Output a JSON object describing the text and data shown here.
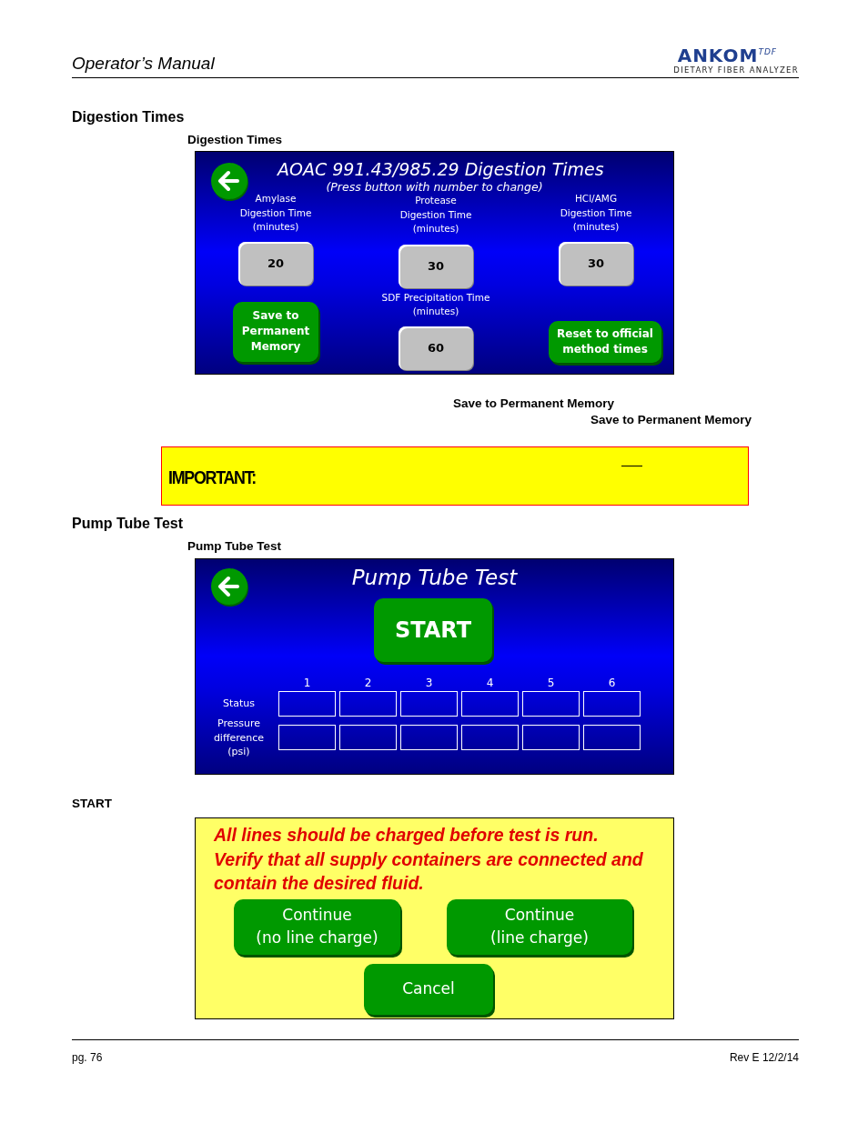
{
  "header": {
    "title": "Operator’s Manual",
    "logo": "ANKOM$^{TDF}$",
    "logo_tagline": "DIETARY FIBER ANALYZER"
  },
  "digestion": {
    "heading": "Digestion Times",
    "caption": "Digestion Times",
    "screen": {
      "title": "AOAC 991.43/985.29 Digestion Times",
      "subtitle": "(Press button with number to change)",
      "fields": [
        {
          "label": "Amylase\nDigestion Time\n(minutes)",
          "value": "20"
        },
        {
          "label": "Protease\nDigestion Time\n(minutes)",
          "value": "30"
        },
        {
          "label": "HCl/AMG\nDigestion Time\n(minutes)",
          "value": "30"
        },
        {
          "label": "SDF Precipitation Time\n(minutes)",
          "value": "60"
        }
      ],
      "save_button": "Save to\nPermanent\nMemory",
      "reset_button": "Reset to official\nmethod times"
    },
    "notes": [
      "Save to Permanent Memory",
      "Save to Permanent Memory"
    ]
  },
  "important": {
    "label": "IMPORTANT:"
  },
  "pump": {
    "heading": "Pump Tube Test",
    "caption": "Pump Tube Test",
    "screen": {
      "title": "Pump Tube Test",
      "start_button": "START",
      "columns": [
        "1",
        "2",
        "3",
        "4",
        "5",
        "6"
      ],
      "rows": [
        {
          "label": "Status"
        },
        {
          "label": "Pressure difference (psi)"
        }
      ]
    },
    "note": "START",
    "dialog": {
      "message": "All lines should be charged before test is run. Verify that all supply containers are connected and contain the desired fluid.",
      "buttons": [
        "Continue\n(no line charge)",
        "Continue\n(line charge)"
      ],
      "cancel": "Cancel"
    }
  },
  "footer": {
    "page": "pg. 76",
    "revision": "Rev E 12/2/14"
  }
}
